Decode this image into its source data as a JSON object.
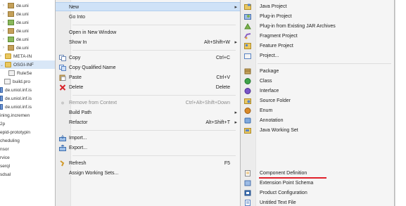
{
  "tree": {
    "items": [
      {
        "label": "de.uni",
        "icon": "package-icon"
      },
      {
        "label": "de.uni",
        "icon": "package-icon"
      },
      {
        "label": "de.uni",
        "icon": "package-icon"
      },
      {
        "label": "de.uni",
        "icon": "package-icon"
      },
      {
        "label": "de.uni",
        "icon": "package-icon"
      },
      {
        "label": "de.uni",
        "icon": "package-icon"
      },
      {
        "label": "META-IN",
        "icon": "folder-icon"
      },
      {
        "label": "OSGI-INF",
        "icon": "folder-icon"
      },
      {
        "label": "RuleSe",
        "icon": "file-icon"
      },
      {
        "label": "build.pro",
        "icon": "file-icon"
      },
      {
        "label": "de.uniol.inf.is",
        "icon": "plugin-icon"
      },
      {
        "label": "de.uniol.inf.is",
        "icon": "plugin-icon"
      },
      {
        "label": "de.uniol.inf.is",
        "icon": "plugin-icon"
      },
      {
        "label": "ining.incremen",
        "icon": ""
      },
      {
        "label": "2p",
        "icon": ""
      },
      {
        "label": "epid-prototypin",
        "icon": ""
      },
      {
        "label": "cheduling",
        "icon": ""
      },
      {
        "label": "nsor",
        "icon": ""
      },
      {
        "label": "rvice",
        "icon": ""
      },
      {
        "label": "serql",
        "icon": ""
      },
      {
        "label": "sdsal",
        "icon": ""
      }
    ]
  },
  "context_menu": {
    "items": [
      {
        "label": "New",
        "shortcut": "",
        "has_submenu": true,
        "highlighted": true,
        "disabled": false,
        "icon": ""
      },
      {
        "label": "Go Into",
        "shortcut": "",
        "has_submenu": false,
        "highlighted": false,
        "disabled": false,
        "icon": ""
      },
      {
        "label": "Open in New Window",
        "shortcut": "",
        "has_submenu": false,
        "highlighted": false,
        "disabled": false,
        "icon": ""
      },
      {
        "label": "Show In",
        "shortcut": "Alt+Shift+W",
        "has_submenu": true,
        "highlighted": false,
        "disabled": false,
        "icon": ""
      },
      {
        "label": "Copy",
        "shortcut": "Ctrl+C",
        "has_submenu": false,
        "highlighted": false,
        "disabled": false,
        "icon": "copy-icon"
      },
      {
        "label": "Copy Qualified Name",
        "shortcut": "",
        "has_submenu": false,
        "highlighted": false,
        "disabled": false,
        "icon": "copy-qualified-name-icon"
      },
      {
        "label": "Paste",
        "shortcut": "Ctrl+V",
        "has_submenu": false,
        "highlighted": false,
        "disabled": false,
        "icon": "paste-icon"
      },
      {
        "label": "Delete",
        "shortcut": "Delete",
        "has_submenu": false,
        "highlighted": false,
        "disabled": false,
        "icon": "delete-icon"
      },
      {
        "label": "Remove from Context",
        "shortcut": "Ctrl+Alt+Shift+Down",
        "has_submenu": false,
        "highlighted": false,
        "disabled": true,
        "icon": "remove-context-icon"
      },
      {
        "label": "Build Path",
        "shortcut": "",
        "has_submenu": true,
        "highlighted": false,
        "disabled": false,
        "icon": ""
      },
      {
        "label": "Refactor",
        "shortcut": "Alt+Shift+T",
        "has_submenu": true,
        "highlighted": false,
        "disabled": false,
        "icon": ""
      },
      {
        "label": "Import...",
        "shortcut": "",
        "has_submenu": false,
        "highlighted": false,
        "disabled": false,
        "icon": "import-icon"
      },
      {
        "label": "Export...",
        "shortcut": "",
        "has_submenu": false,
        "highlighted": false,
        "disabled": false,
        "icon": "export-icon"
      },
      {
        "label": "Refresh",
        "shortcut": "F5",
        "has_submenu": false,
        "highlighted": false,
        "disabled": false,
        "icon": "refresh-icon"
      },
      {
        "label": "Assign Working Sets...",
        "shortcut": "",
        "has_submenu": false,
        "highlighted": false,
        "disabled": false,
        "icon": ""
      }
    ]
  },
  "submenu": {
    "items": [
      {
        "label": "Java Project",
        "icon": "java-project-icon"
      },
      {
        "label": "Plug-in Project",
        "icon": "plugin-project-icon"
      },
      {
        "label": "Plug-in from Existing JAR Archives",
        "icon": "plugin-jar-icon"
      },
      {
        "label": "Fragment Project",
        "icon": "fragment-project-icon"
      },
      {
        "label": "Feature Project",
        "icon": "feature-project-icon"
      },
      {
        "label": "Project...",
        "icon": "project-icon"
      },
      {
        "label": "Package",
        "icon": "package-icon"
      },
      {
        "label": "Class",
        "icon": "class-icon"
      },
      {
        "label": "Interface",
        "icon": "interface-icon"
      },
      {
        "label": "Source Folder",
        "icon": "source-folder-icon"
      },
      {
        "label": "Enum",
        "icon": "enum-icon"
      },
      {
        "label": "Annotation",
        "icon": "annotation-icon"
      },
      {
        "label": "Java Working Set",
        "icon": "working-set-icon"
      },
      {
        "label": "Component Definition",
        "icon": "component-definition-icon"
      },
      {
        "label": "Extension Point Schema",
        "icon": "extension-point-schema-icon"
      },
      {
        "label": "Product Configuration",
        "icon": "product-configuration-icon"
      },
      {
        "label": "Untitled Text File",
        "icon": "text-file-icon"
      }
    ]
  },
  "colors": {
    "highlight": "#cfe2f7",
    "underline": "#e0212b",
    "menu_bg": "#f5f5f5"
  }
}
